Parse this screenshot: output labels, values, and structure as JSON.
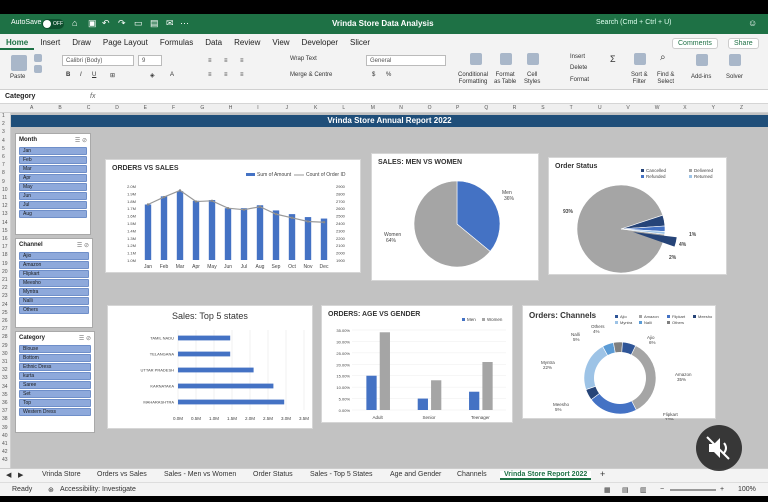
{
  "titlebar": {
    "autosave": "AutoSave",
    "toggle": "OFF",
    "title": "Vrinda Store Data Analysis",
    "search": "Search (Cmd + Ctrl + U)"
  },
  "ribbon_tabs": [
    "Home",
    "Insert",
    "Draw",
    "Page Layout",
    "Formulas",
    "Data",
    "Review",
    "View",
    "Developer",
    "Slicer"
  ],
  "ribbon_right": {
    "comments": "Comments",
    "share": "Share"
  },
  "ribbon": {
    "paste": "Paste",
    "font": "Calibri (Body)",
    "size": "9",
    "wrap": "Wrap Text",
    "merge": "Merge & Centre",
    "numfmt": "General",
    "cond": "Conditional\nFormatting",
    "fmt_table": "Format\nas Table",
    "cell_styles": "Cell\nStyles",
    "insert": "Insert",
    "delete": "Delete",
    "format": "Format",
    "sort": "Sort &\nFilter",
    "find": "Find &\nSelect",
    "addins": "Add-ins",
    "analyse": "Analyse\nData",
    "solver": "Solver"
  },
  "formula_bar": {
    "namebox": "Category",
    "fx": "fx"
  },
  "columns": [
    "A",
    "B",
    "C",
    "D",
    "E",
    "F",
    "G",
    "H",
    "I",
    "J",
    "K",
    "L",
    "M",
    "N",
    "O",
    "P",
    "Q",
    "R",
    "S",
    "T",
    "U",
    "V",
    "W",
    "X",
    "Y",
    "Z"
  ],
  "rows": [
    "1",
    "2",
    "3",
    "4",
    "5",
    "6",
    "7",
    "8",
    "9",
    "10",
    "11",
    "12",
    "13",
    "14",
    "15",
    "16",
    "17",
    "18",
    "19",
    "20",
    "21",
    "22",
    "23",
    "24",
    "25",
    "26",
    "27",
    "28",
    "29",
    "30",
    "31",
    "32",
    "33",
    "34",
    "35",
    "36",
    "37",
    "38",
    "39",
    "40",
    "41",
    "42",
    "43"
  ],
  "banner": "Vrinda Store Annual Report 2022",
  "slicers": {
    "month": {
      "title": "Month",
      "items": [
        "Jan",
        "Feb",
        "Mar",
        "Apr",
        "May",
        "Jun",
        "Jul",
        "Aug"
      ]
    },
    "channel": {
      "title": "Channel",
      "items": [
        "Ajio",
        "Amazon",
        "Flipkart",
        "Meesho",
        "Myntra",
        "Nalli",
        "Others"
      ]
    },
    "category": {
      "title": "Category",
      "items": [
        "Blouse",
        "Bottom",
        "Ethnic Dress",
        "kurta",
        "Saree",
        "Set",
        "Top",
        "Western Dress"
      ]
    }
  },
  "chart_data": [
    {
      "type": "bar",
      "title": "ORDERS VS SALES",
      "categories": [
        "Jan",
        "Feb",
        "Mar",
        "Apr",
        "May",
        "Jun",
        "Jul",
        "Aug",
        "Sep",
        "Oct",
        "Nov",
        "Dec"
      ],
      "series": [
        {
          "name": "Sum of Amount",
          "values": [
            1.75,
            1.86,
            1.93,
            1.8,
            1.81,
            1.7,
            1.7,
            1.74,
            1.67,
            1.62,
            1.58,
            1.56
          ]
        },
        {
          "name": "Count of Order ID",
          "values": [
            2650,
            2750,
            2840,
            2690,
            2700,
            2600,
            2580,
            2620,
            2520,
            2470,
            2420,
            2410
          ]
        }
      ],
      "yticks_left": [
        "2.0M",
        "1.9M",
        "1.8M",
        "1.7M",
        "1.6M",
        "1.5M",
        "1.4M",
        "1.3M",
        "1.2M",
        "1.1M",
        "1.0M"
      ],
      "yticks_right": [
        "2900",
        "2800",
        "2700",
        "2600",
        "2500",
        "2400",
        "2300",
        "2200",
        "2100",
        "2000",
        "1900"
      ],
      "ylim": [
        1.4,
        2.0
      ],
      "ylim_right": [
        2300,
        2900
      ]
    },
    {
      "type": "pie",
      "title": "SALES: MEN VS WOMEN",
      "slices": [
        {
          "name": "Men",
          "value": 36
        },
        {
          "name": "Women",
          "value": 64
        }
      ],
      "labels": [
        "Men\n36%",
        "Women\n64%"
      ],
      "colors": [
        "#4472c4",
        "#a5a5a5"
      ]
    },
    {
      "type": "pie",
      "title": "Order Status",
      "legend": [
        "Cancelled",
        "Delivered",
        "Refunded",
        "Returned"
      ],
      "slices": [
        {
          "name": "Delivered",
          "value": 93
        },
        {
          "name": "Cancelled",
          "value": 4
        },
        {
          "name": "Refunded",
          "value": 2
        },
        {
          "name": "Returned",
          "value": 1
        }
      ],
      "labels": [
        "93%",
        "4%",
        "2%",
        "1%"
      ],
      "colors": [
        "#a5a5a5",
        "#264478",
        "#4472c4",
        "#9dc3e6"
      ]
    },
    {
      "type": "bar",
      "title": "Sales: Top 5 states",
      "categories": [
        "TAMIL NADU",
        "TELANGANA",
        "UTTAR PRADESH",
        "KARNATAKA",
        "MAHARASHTRA"
      ],
      "values": [
        1.45,
        1.45,
        2.1,
        2.65,
        2.95
      ],
      "xticks": [
        "0.0M",
        "0.5M",
        "1.0M",
        "1.5M",
        "2.0M",
        "2.5M",
        "3.0M",
        "3.5M"
      ],
      "xlim": [
        0,
        3.5
      ]
    },
    {
      "type": "bar",
      "title": "ORDERS: AGE VS GENDER",
      "categories": [
        "Adult",
        "Senior",
        "Teenager"
      ],
      "series": [
        {
          "name": "Men",
          "values": [
            0.15,
            0.05,
            0.08
          ]
        },
        {
          "name": "Women",
          "values": [
            0.34,
            0.13,
            0.21
          ]
        }
      ],
      "yticks": [
        "35.00%",
        "30.00%",
        "25.00%",
        "20.00%",
        "15.00%",
        "10.00%",
        "5.00%",
        "0.00%"
      ],
      "ylim": [
        0,
        0.35
      ]
    },
    {
      "type": "pie",
      "title": "Orders: Channels",
      "legend": [
        "Ajio",
        "Amazon",
        "Flipkart",
        "Meesho",
        "Myntra",
        "Nalli",
        "Others"
      ],
      "slices": [
        {
          "name": "Amazon",
          "value": 35
        },
        {
          "name": "Flipkart",
          "value": 22
        },
        {
          "name": "Meesho",
          "value": 5
        },
        {
          "name": "Myntra",
          "value": 22
        },
        {
          "name": "Nalli",
          "value": 5
        },
        {
          "name": "Others",
          "value": 4
        },
        {
          "name": "Ajio",
          "value": 6
        }
      ],
      "labels": [
        "Amazon\n35%",
        "Flipkart\n22%",
        "Meesho\n5%",
        "Myntra\n22%",
        "Nalli\n5%",
        "Others\n4%",
        "Ajio\n6%"
      ],
      "colors": [
        "#a5a5a5",
        "#4472c4",
        "#264478",
        "#9dc3e6",
        "#5b9bd5",
        "#7f7f7f",
        "#2f5597"
      ]
    }
  ],
  "sheet_tabs": [
    "Vrinda Store",
    "Orders vs Sales",
    "Sales -  Men vs Women",
    "Order Status",
    "Sales - Top 5 States",
    "Age and Gender",
    "Channels",
    "Vrinda Store Report 2022"
  ],
  "status": {
    "ready": "Ready",
    "accessibility": "Accessibility: Investigate",
    "zoom": "100%"
  }
}
